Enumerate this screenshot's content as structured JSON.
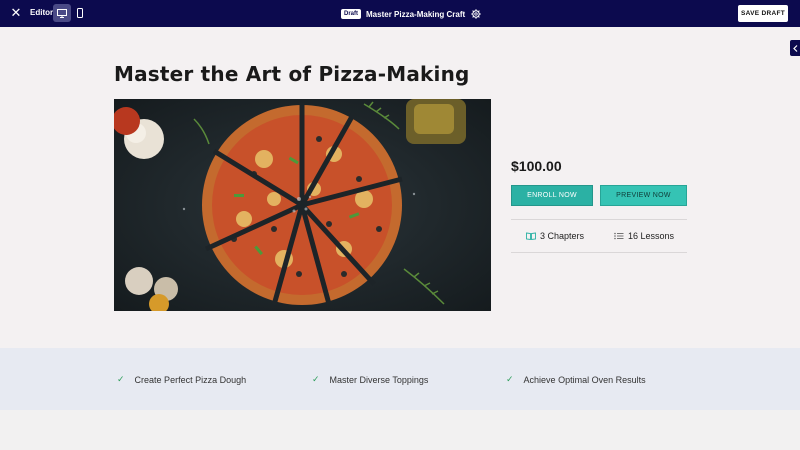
{
  "topbar": {
    "close_icon": "close-icon",
    "editor_label": "Editor",
    "desktop_icon": "desktop-icon",
    "mobile_icon": "mobile-icon",
    "draft_badge": "Draft",
    "course_title": "Master Pizza-Making Craft",
    "settings_icon": "gear-icon",
    "save_label": "SAVE DRAFT",
    "bg_color": "#0c0a4e"
  },
  "side_toggle_icon": "chevron-left-icon",
  "main": {
    "title": "Master the Art of Pizza-Making",
    "hero_image": "pizza-image",
    "price": "$100.00",
    "enroll_label": "ENROLL NOW",
    "preview_label": "PREVIEW NOW",
    "chapters": "3 Chapters",
    "lessons": "16 Lessons",
    "accent_color": "#2bb1a4"
  },
  "features": [
    "Create Perfect Pizza Dough",
    "Master Diverse Toppings",
    "Achieve Optimal Oven Results"
  ]
}
